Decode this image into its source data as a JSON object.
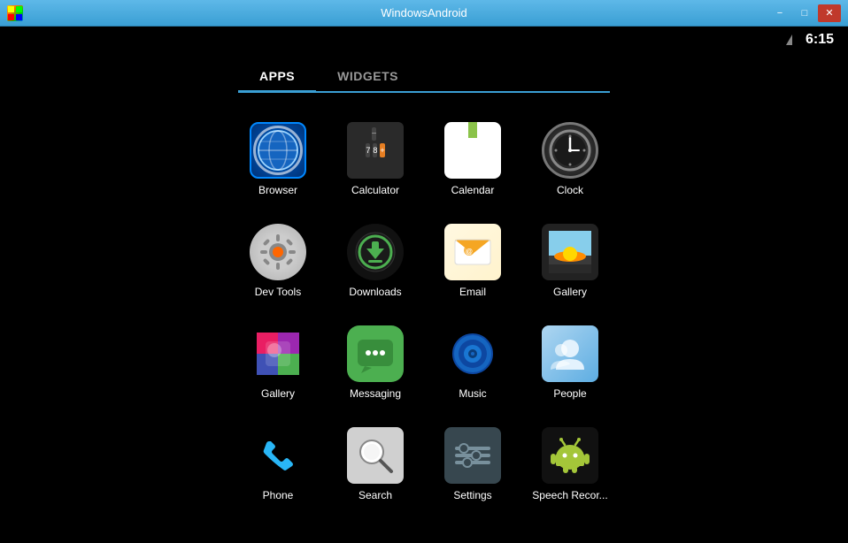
{
  "window": {
    "title": "WindowsAndroid",
    "minimize_label": "−",
    "restore_label": "□",
    "close_label": "✕"
  },
  "status_bar": {
    "time": "6:15"
  },
  "tabs": [
    {
      "id": "apps",
      "label": "APPS",
      "active": true
    },
    {
      "id": "widgets",
      "label": "WIDGETS",
      "active": false
    }
  ],
  "apps": [
    {
      "id": "browser",
      "label": "Browser",
      "row": 1
    },
    {
      "id": "calculator",
      "label": "Calculator",
      "row": 1
    },
    {
      "id": "calendar",
      "label": "Calendar",
      "row": 1
    },
    {
      "id": "clock",
      "label": "Clock",
      "row": 1
    },
    {
      "id": "devtools",
      "label": "Dev Tools",
      "row": 2
    },
    {
      "id": "downloads",
      "label": "Downloads",
      "row": 2
    },
    {
      "id": "email",
      "label": "Email",
      "row": 2
    },
    {
      "id": "gallery1",
      "label": "Gallery",
      "row": 2
    },
    {
      "id": "gallery2",
      "label": "Gallery",
      "row": 3
    },
    {
      "id": "messaging",
      "label": "Messaging",
      "row": 3
    },
    {
      "id": "music",
      "label": "Music",
      "row": 3
    },
    {
      "id": "people",
      "label": "People",
      "row": 3
    },
    {
      "id": "phone",
      "label": "Phone",
      "row": 4
    },
    {
      "id": "search",
      "label": "Search",
      "row": 4
    },
    {
      "id": "settings",
      "label": "Settings",
      "row": 4
    },
    {
      "id": "speech",
      "label": "Speech Recor...",
      "row": 4
    }
  ]
}
